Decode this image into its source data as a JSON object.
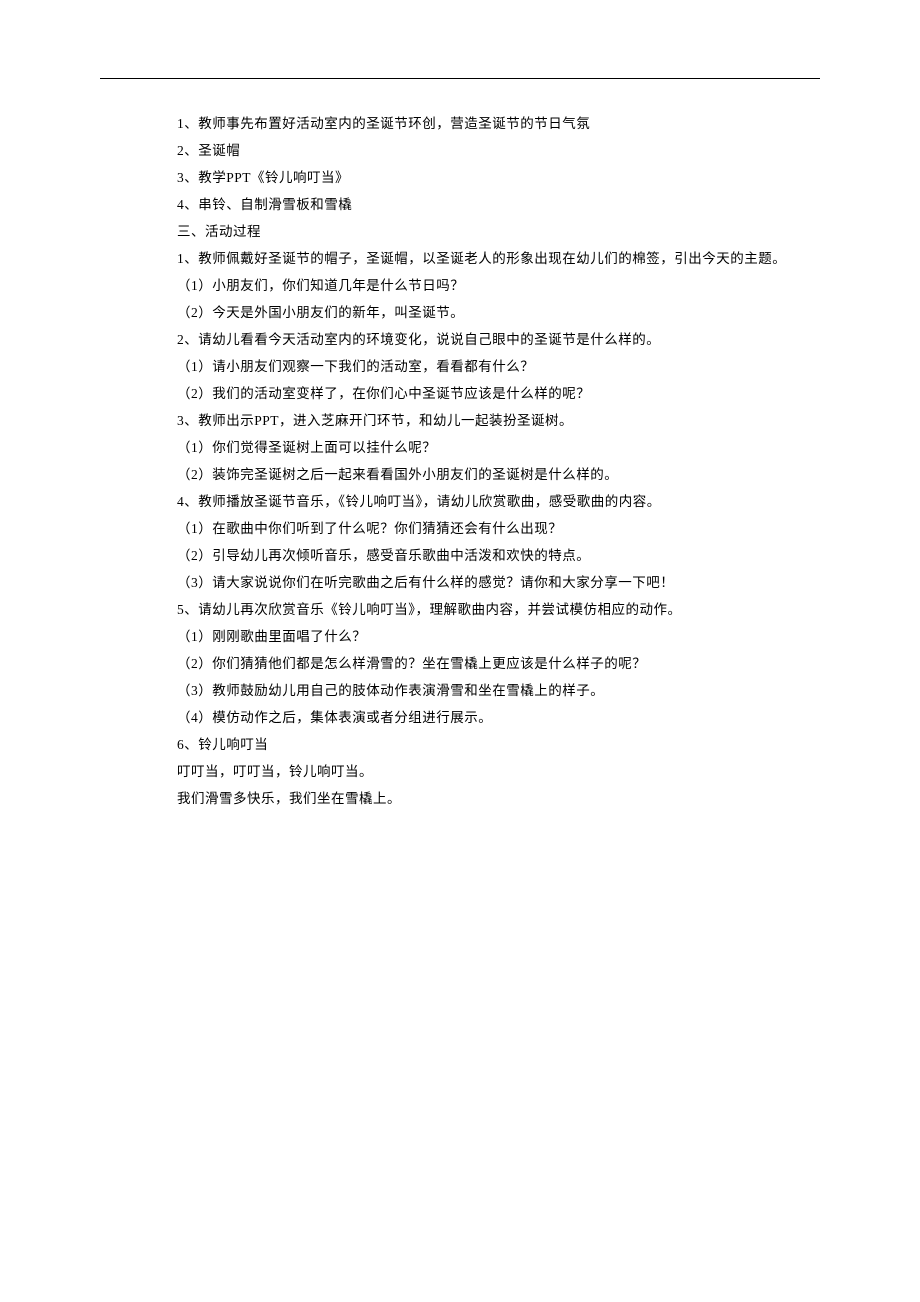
{
  "lines": [
    "1、教师事先布置好活动室内的圣诞节环创，营造圣诞节的节日气氛",
    "2、圣诞帽",
    "3、教学PPT《铃儿响叮当》",
    "4、串铃、自制滑雪板和雪橇",
    "三、活动过程",
    "1、教师佩戴好圣诞节的帽子，圣诞帽，以圣诞老人的形象出现在幼儿们的棉签，引出今天的主题。",
    "（1）小朋友们，你们知道几年是什么节日吗？",
    "（2）今天是外国小朋友们的新年，叫圣诞节。",
    "2、请幼儿看看今天活动室内的环境变化，说说自己眼中的圣诞节是什么样的。",
    "（1）请小朋友们观察一下我们的活动室，看看都有什么？",
    "（2）我们的活动室变样了，在你们心中圣诞节应该是什么样的呢？",
    "3、教师出示PPT，进入芝麻开门环节，和幼儿一起装扮圣诞树。",
    "（1）你们觉得圣诞树上面可以挂什么呢？",
    "（2）装饰完圣诞树之后一起来看看国外小朋友们的圣诞树是什么样的。",
    "4、教师播放圣诞节音乐，《铃儿响叮当》，请幼儿欣赏歌曲，感受歌曲的内容。",
    "（1）在歌曲中你们听到了什么呢？你们猜猜还会有什么出现？",
    "（2）引导幼儿再次倾听音乐，感受音乐歌曲中活泼和欢快的特点。",
    "（3）请大家说说你们在听完歌曲之后有什么样的感觉？请你和大家分享一下吧！",
    "5、请幼儿再次欣赏音乐《铃儿响叮当》，理解歌曲内容，并尝试模仿相应的动作。",
    "（1）刚刚歌曲里面唱了什么？",
    "（2）你们猜猜他们都是怎么样滑雪的？坐在雪橇上更应该是什么样子的呢？",
    "（3）教师鼓励幼儿用自己的肢体动作表演滑雪和坐在雪橇上的样子。",
    "（4）模仿动作之后，集体表演或者分组进行展示。",
    "6、铃儿响叮当",
    "叮叮当，叮叮当，铃儿响叮当。",
    "我们滑雪多快乐，我们坐在雪橇上。"
  ]
}
